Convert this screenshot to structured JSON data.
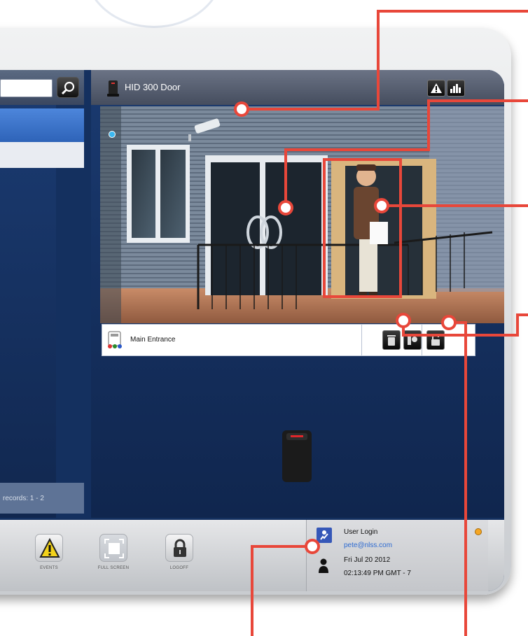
{
  "search": {
    "value": ""
  },
  "left_list": {
    "records_text": "records: 1 - 2"
  },
  "door": {
    "title": "HID 300 Door",
    "status_name": "Main Entrance"
  },
  "toolbar": {
    "events_label": "EVENTS",
    "fullscreen_label": "FULL SCREEN",
    "logoff_label": "LOGOFF"
  },
  "user": {
    "login_label": "User Login",
    "email": "pete@nlss.com",
    "date": "Fri Jul 20 2012",
    "time": "02:13:49 PM GMT - 7"
  },
  "colors": {
    "callout": "#e8473a",
    "accent_blue": "#2e63b8",
    "status_dot": "#3bb7f0",
    "alert_orange": "#f5a623"
  },
  "icons": {
    "search": "magnifier-icon",
    "door": "door-reader-icon",
    "alarm": "warning-icon",
    "stats": "bar-chart-icon",
    "trash": "trash-icon",
    "intercom": "intercom-icon",
    "unlock": "unlock-icon",
    "events": "warning-icon",
    "fullscreen": "fullscreen-icon",
    "logoff": "lock-icon",
    "user": "user-check-icon",
    "person": "person-icon"
  }
}
